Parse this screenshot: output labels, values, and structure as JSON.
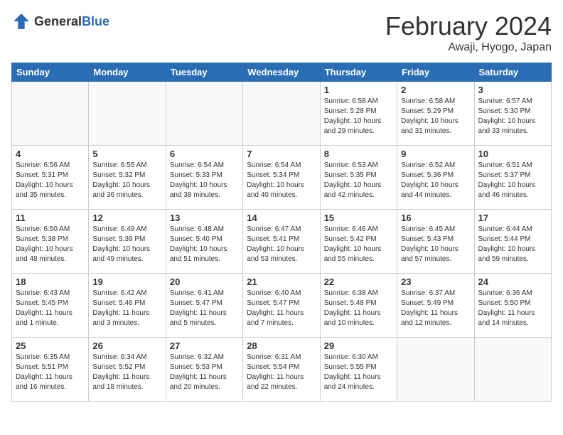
{
  "header": {
    "logo_general": "General",
    "logo_blue": "Blue",
    "month": "February 2024",
    "location": "Awaji, Hyogo, Japan"
  },
  "weekdays": [
    "Sunday",
    "Monday",
    "Tuesday",
    "Wednesday",
    "Thursday",
    "Friday",
    "Saturday"
  ],
  "weeks": [
    [
      {
        "day": "",
        "info": ""
      },
      {
        "day": "",
        "info": ""
      },
      {
        "day": "",
        "info": ""
      },
      {
        "day": "",
        "info": ""
      },
      {
        "day": "1",
        "info": "Sunrise: 6:58 AM\nSunset: 5:28 PM\nDaylight: 10 hours\nand 29 minutes."
      },
      {
        "day": "2",
        "info": "Sunrise: 6:58 AM\nSunset: 5:29 PM\nDaylight: 10 hours\nand 31 minutes."
      },
      {
        "day": "3",
        "info": "Sunrise: 6:57 AM\nSunset: 5:30 PM\nDaylight: 10 hours\nand 33 minutes."
      }
    ],
    [
      {
        "day": "4",
        "info": "Sunrise: 6:56 AM\nSunset: 5:31 PM\nDaylight: 10 hours\nand 35 minutes."
      },
      {
        "day": "5",
        "info": "Sunrise: 6:55 AM\nSunset: 5:32 PM\nDaylight: 10 hours\nand 36 minutes."
      },
      {
        "day": "6",
        "info": "Sunrise: 6:54 AM\nSunset: 5:33 PM\nDaylight: 10 hours\nand 38 minutes."
      },
      {
        "day": "7",
        "info": "Sunrise: 6:54 AM\nSunset: 5:34 PM\nDaylight: 10 hours\nand 40 minutes."
      },
      {
        "day": "8",
        "info": "Sunrise: 6:53 AM\nSunset: 5:35 PM\nDaylight: 10 hours\nand 42 minutes."
      },
      {
        "day": "9",
        "info": "Sunrise: 6:52 AM\nSunset: 5:36 PM\nDaylight: 10 hours\nand 44 minutes."
      },
      {
        "day": "10",
        "info": "Sunrise: 6:51 AM\nSunset: 5:37 PM\nDaylight: 10 hours\nand 46 minutes."
      }
    ],
    [
      {
        "day": "11",
        "info": "Sunrise: 6:50 AM\nSunset: 5:38 PM\nDaylight: 10 hours\nand 48 minutes."
      },
      {
        "day": "12",
        "info": "Sunrise: 6:49 AM\nSunset: 5:39 PM\nDaylight: 10 hours\nand 49 minutes."
      },
      {
        "day": "13",
        "info": "Sunrise: 6:48 AM\nSunset: 5:40 PM\nDaylight: 10 hours\nand 51 minutes."
      },
      {
        "day": "14",
        "info": "Sunrise: 6:47 AM\nSunset: 5:41 PM\nDaylight: 10 hours\nand 53 minutes."
      },
      {
        "day": "15",
        "info": "Sunrise: 6:46 AM\nSunset: 5:42 PM\nDaylight: 10 hours\nand 55 minutes."
      },
      {
        "day": "16",
        "info": "Sunrise: 6:45 AM\nSunset: 5:43 PM\nDaylight: 10 hours\nand 57 minutes."
      },
      {
        "day": "17",
        "info": "Sunrise: 6:44 AM\nSunset: 5:44 PM\nDaylight: 10 hours\nand 59 minutes."
      }
    ],
    [
      {
        "day": "18",
        "info": "Sunrise: 6:43 AM\nSunset: 5:45 PM\nDaylight: 11 hours\nand 1 minute."
      },
      {
        "day": "19",
        "info": "Sunrise: 6:42 AM\nSunset: 5:46 PM\nDaylight: 11 hours\nand 3 minutes."
      },
      {
        "day": "20",
        "info": "Sunrise: 6:41 AM\nSunset: 5:47 PM\nDaylight: 11 hours\nand 5 minutes."
      },
      {
        "day": "21",
        "info": "Sunrise: 6:40 AM\nSunset: 5:47 PM\nDaylight: 11 hours\nand 7 minutes."
      },
      {
        "day": "22",
        "info": "Sunrise: 6:38 AM\nSunset: 5:48 PM\nDaylight: 11 hours\nand 10 minutes."
      },
      {
        "day": "23",
        "info": "Sunrise: 6:37 AM\nSunset: 5:49 PM\nDaylight: 11 hours\nand 12 minutes."
      },
      {
        "day": "24",
        "info": "Sunrise: 6:36 AM\nSunset: 5:50 PM\nDaylight: 11 hours\nand 14 minutes."
      }
    ],
    [
      {
        "day": "25",
        "info": "Sunrise: 6:35 AM\nSunset: 5:51 PM\nDaylight: 11 hours\nand 16 minutes."
      },
      {
        "day": "26",
        "info": "Sunrise: 6:34 AM\nSunset: 5:52 PM\nDaylight: 11 hours\nand 18 minutes."
      },
      {
        "day": "27",
        "info": "Sunrise: 6:32 AM\nSunset: 5:53 PM\nDaylight: 11 hours\nand 20 minutes."
      },
      {
        "day": "28",
        "info": "Sunrise: 6:31 AM\nSunset: 5:54 PM\nDaylight: 11 hours\nand 22 minutes."
      },
      {
        "day": "29",
        "info": "Sunrise: 6:30 AM\nSunset: 5:55 PM\nDaylight: 11 hours\nand 24 minutes."
      },
      {
        "day": "",
        "info": ""
      },
      {
        "day": "",
        "info": ""
      }
    ]
  ]
}
